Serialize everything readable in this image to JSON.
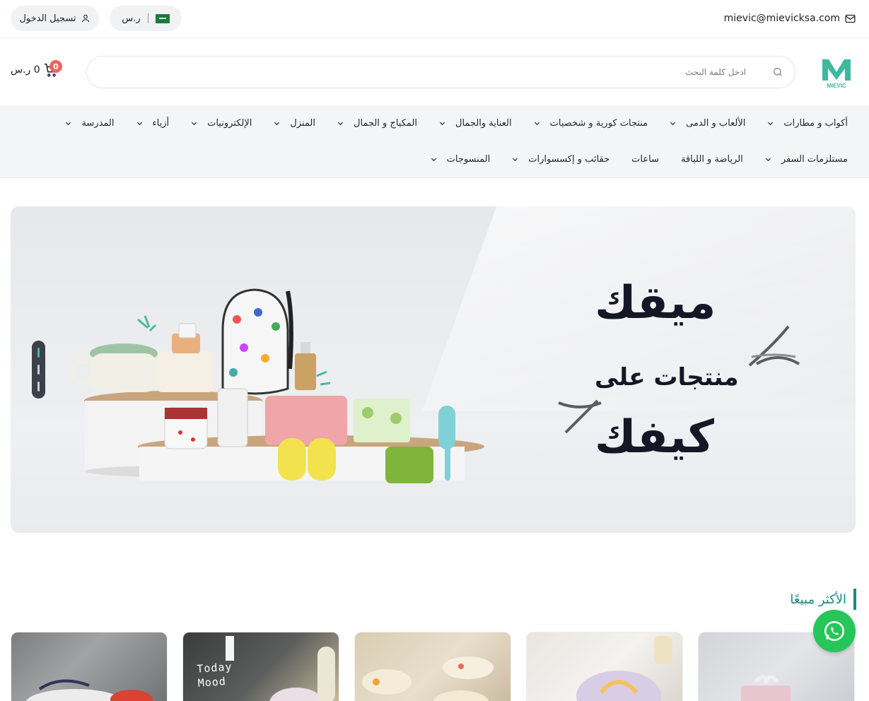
{
  "topbar": {
    "email": "mievic@mievicksa.com",
    "currency_label": "ر.س",
    "login_label": "تسجيل الدخول",
    "icons": {
      "email": "mail-icon",
      "login": "user-icon",
      "flag": "saudi-flag-icon"
    }
  },
  "header": {
    "logo_text": "MIEVIC",
    "search_placeholder": "ادخل كلمة البحث",
    "cart_total": "0 ر.س",
    "cart_count": "0",
    "brand_color": "#3fb8a0"
  },
  "nav": {
    "row1": [
      {
        "label": "أكواب و مطارات",
        "dropdown": true
      },
      {
        "label": "الألعاب و الدمى",
        "dropdown": true
      },
      {
        "label": "منتجات كورية و شخصيات",
        "dropdown": true
      },
      {
        "label": "العناية والجمال",
        "dropdown": true
      },
      {
        "label": "المكياج و الجمال",
        "dropdown": true
      },
      {
        "label": "المنزل",
        "dropdown": true
      },
      {
        "label": "الإلكترونيات",
        "dropdown": true
      },
      {
        "label": "أزياء",
        "dropdown": true
      },
      {
        "label": "المدرسة",
        "dropdown": true
      }
    ],
    "row2": [
      {
        "label": "مستلزمات السفر",
        "dropdown": true
      },
      {
        "label": "الرياضة و اللياقة",
        "dropdown": false
      },
      {
        "label": "ساعات",
        "dropdown": false
      },
      {
        "label": "حقائب و إكسسوارات",
        "dropdown": true
      },
      {
        "label": "المنسوجات",
        "dropdown": true
      }
    ]
  },
  "hero": {
    "line1": "ميقك",
    "line2": "منتجات على",
    "line3": "كيفك",
    "slide_index": 1,
    "slide_count": 3
  },
  "section": {
    "title": "الأكثر مبيعًا"
  },
  "products": [
    {
      "image": "cups-photo-1"
    },
    {
      "image": "today-mood-board-photo",
      "image_text": [
        "Today",
        "Mood"
      ]
    },
    {
      "image": "cups-photo-2"
    },
    {
      "image": "plate-photo"
    },
    {
      "image": "gift-box-photo"
    }
  ],
  "whatsapp": {
    "icon": "whatsapp-icon",
    "color": "#27c65a"
  }
}
